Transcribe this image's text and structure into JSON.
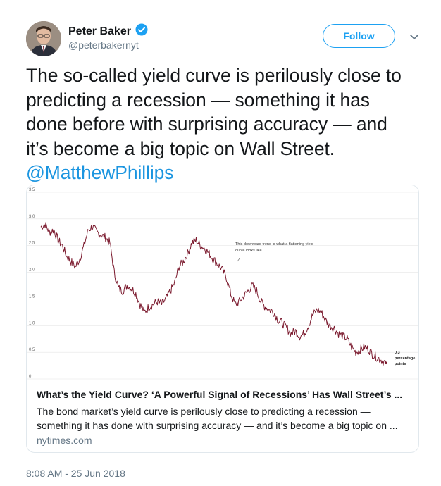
{
  "author": {
    "name": "Peter Baker",
    "handle": "@peterbakernyt",
    "verified": true
  },
  "follow_label": "Follow",
  "tweet": {
    "lines": [
      "The so-called yield curve is perilously close to",
      "predicting a recession — something it has",
      "done before with surprising accuracy — and",
      "it’s become a big topic on Wall Street."
    ],
    "mention": "@MatthewPhillips"
  },
  "card": {
    "title": "What’s the Yield Curve? ‘A Powerful Signal of Recessions’ Has Wall Street’s ...",
    "description_lines": [
      "The bond market’s yield curve is perilously close to predicting a recession —",
      "something it has done with surprising accuracy — and it’s become a big topic on ..."
    ],
    "domain": "nytimes.com"
  },
  "timestamp": "8:08 AM - 25 Jun 2018",
  "colors": {
    "accent": "#1da1f2",
    "link": "#1b95e0",
    "line": "#7b1a2e"
  },
  "chart_data": {
    "type": "line",
    "title": "",
    "xlabel": "",
    "ylabel": "",
    "ylim": [
      0,
      3.5
    ],
    "yticks": [
      "0",
      "0.5",
      "1.0",
      "1.5",
      "2.0",
      "2.5",
      "3.0",
      "3.5"
    ],
    "grid": true,
    "annotation": [
      "This downward trend is what a flattening yield",
      "curve looks like."
    ],
    "end_label": [
      "0.3",
      "percentage",
      "points"
    ],
    "series": [
      {
        "values": [
          2.85,
          2.9,
          2.75,
          2.8,
          2.6,
          2.5,
          2.3,
          2.2,
          2.1,
          2.25,
          2.5,
          2.8,
          2.85,
          2.75,
          2.7,
          2.65,
          2.55,
          2.0,
          1.7,
          1.65,
          1.75,
          1.7,
          1.6,
          1.4,
          1.25,
          1.35,
          1.4,
          1.45,
          1.4,
          1.5,
          1.65,
          1.8,
          2.1,
          2.2,
          2.35,
          2.55,
          2.6,
          2.5,
          2.45,
          2.35,
          2.25,
          2.15,
          2.05,
          1.9,
          1.6,
          1.4,
          1.45,
          1.55,
          1.65,
          1.75,
          1.65,
          1.45,
          1.35,
          1.3,
          1.25,
          1.1,
          1.05,
          0.95,
          0.85,
          0.9,
          0.8,
          0.85,
          1.0,
          1.2,
          1.3,
          1.25,
          1.1,
          1.0,
          0.95,
          0.85,
          0.8,
          0.75,
          0.6,
          0.5,
          0.55,
          0.6,
          0.55,
          0.45,
          0.4,
          0.35,
          0.3
        ]
      }
    ]
  }
}
